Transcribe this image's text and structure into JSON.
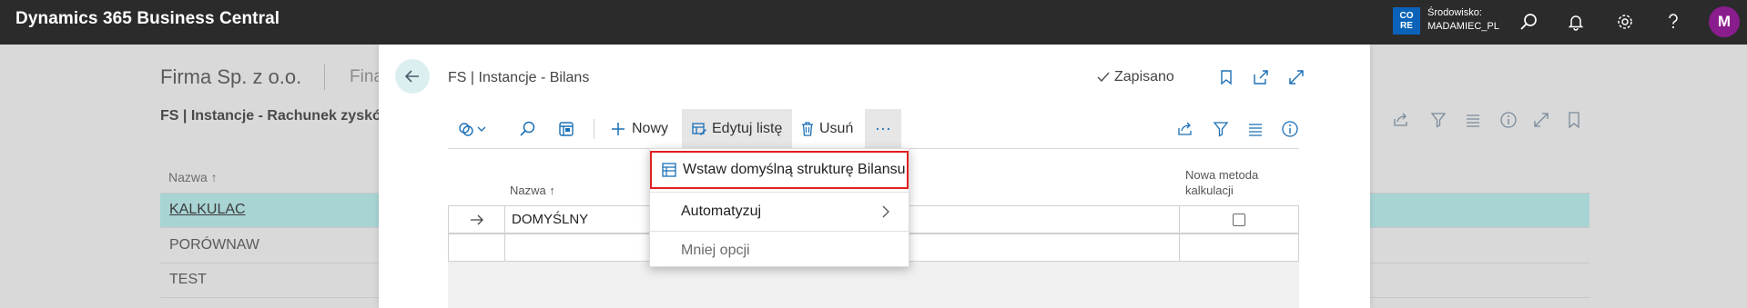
{
  "app": {
    "title": "Dynamics 365 Business Central",
    "env_badge_line1": "CO",
    "env_badge_line2": "RE",
    "env_label": "Środowisko:",
    "env_value": "MADAMIEC_PL",
    "user_initial": "M",
    "accent": "#0a63b8",
    "avatar_color": "#8a1d8e"
  },
  "background": {
    "company": "Firma Sp. z o.o.",
    "company_next": "Fina",
    "page_title": "FS | Instancje - Rachunek zysków i",
    "column_header": "Nazwa ↑",
    "rows": [
      "KALKULAC",
      "PORÓWNAW",
      "TEST"
    ]
  },
  "dialog": {
    "title": "FS | Instancje - Bilans",
    "saved": "Zapisano",
    "actions": {
      "new": "Nowy",
      "edit_list": "Edytuj listę",
      "delete": "Usuń",
      "more": "···"
    },
    "columns": {
      "name": "Nazwa ↑",
      "new_method_line1": "Nowa metoda",
      "new_method_line2": "kalkulacji"
    },
    "rows": [
      {
        "name": "DOMYŚLNY",
        "new_method": false
      },
      {
        "name": "",
        "new_method": null
      }
    ]
  },
  "menu": {
    "insert_default": "Wstaw domyślną strukturę Bilansu",
    "automate": "Automatyzuj",
    "fewer_options": "Mniej opcji"
  }
}
